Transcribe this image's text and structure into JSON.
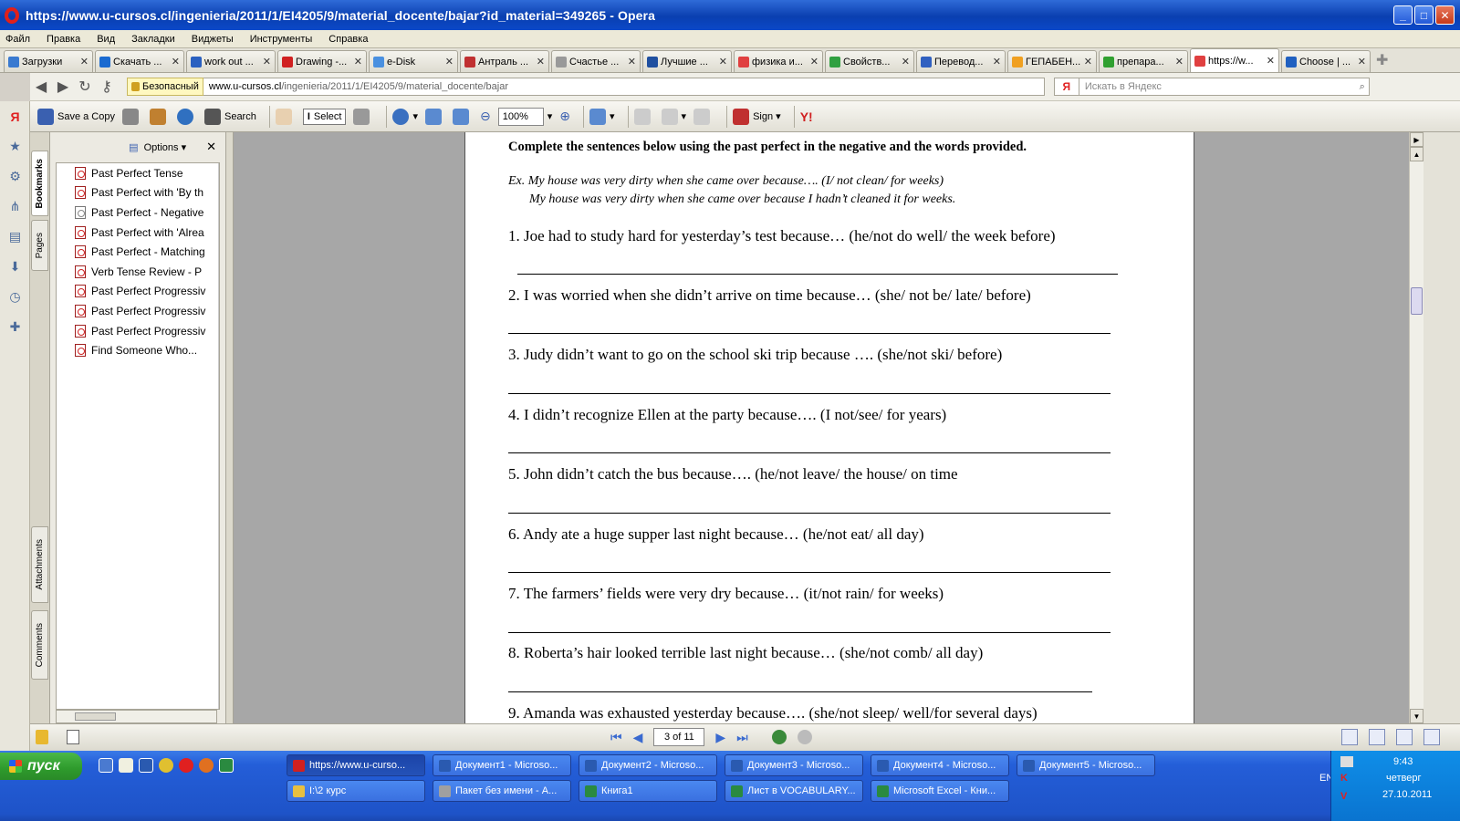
{
  "window": {
    "title": "https://www.u-cursos.cl/ingenieria/2011/1/EI4205/9/material_docente/bajar?id_material=349265 - Opera"
  },
  "menu": [
    "Файл",
    "Правка",
    "Вид",
    "Закладки",
    "Виджеты",
    "Инструменты",
    "Справка"
  ],
  "tabs": [
    {
      "label": "Загрузки",
      "color": "#3a7ad0"
    },
    {
      "label": "Скачать ...",
      "color": "#1a6ad0"
    },
    {
      "label": "work out ...",
      "color": "#2a60c0"
    },
    {
      "label": "Drawing -...",
      "color": "#d02020"
    },
    {
      "label": "e-Disk",
      "color": "#4a90e0"
    },
    {
      "label": "Антраль ...",
      "color": "#c03030"
    },
    {
      "label": "Счастье ...",
      "color": "#999999"
    },
    {
      "label": "Лучшие ...",
      "color": "#2050a0"
    },
    {
      "label": "физика и...",
      "color": "#e04040"
    },
    {
      "label": "Свойств...",
      "color": "#30a040"
    },
    {
      "label": "Перевод...",
      "color": "#3060c0"
    },
    {
      "label": "ГЕПАБЕН...",
      "color": "#f0a020"
    },
    {
      "label": "препара...",
      "color": "#30a030"
    },
    {
      "label": "https://w...",
      "color": "#e04040",
      "active": true
    },
    {
      "label": "Choose | ...",
      "color": "#2060c0"
    }
  ],
  "address": {
    "secure_label": "Безопасный",
    "url_host": "www.u-cursos.cl",
    "url_path": "/ingenieria/2011/1/EI4205/9/material_docente/bajar",
    "search_placeholder": "Искать в Яндекс",
    "search_engine": "Я"
  },
  "reader_toolbar": {
    "save_copy": "Save a Copy",
    "search": "Search",
    "select": "Select",
    "zoom": "100%",
    "sign": "Sign"
  },
  "bookmarks_panel": {
    "tab_bookmarks": "Bookmarks",
    "tab_pages": "Pages",
    "tab_attachments": "Attachments",
    "tab_comments": "Comments",
    "options": "Options",
    "items": [
      "Past Perfect Tense",
      "Past Perfect with 'By th",
      "Past Perfect - Negative",
      "Past Perfect with 'Alrea",
      "Past Perfect - Matching",
      "Verb Tense Review - P",
      "Past Perfect Progressiv",
      "Past Perfect Progressiv",
      "Past Perfect Progressiv",
      "Find Someone Who..."
    ]
  },
  "document": {
    "instruction": "Complete the sentences below using the past perfect in the negative and the words provided.",
    "example_1": "Ex.  My house was very dirty when she came over because…. (I/ not clean/ for weeks)",
    "example_2": "My house was very dirty when she came over because I hadn’t cleaned it for weeks.",
    "questions": [
      "1. Joe had to study hard for yesterday’s test because… (he/not do well/ the week before)",
      "2. I was worried when she didn’t arrive on time because… (she/ not be/ late/ before)",
      "3. Judy didn’t want to go on the school ski trip because …. (she/not ski/ before)",
      "4. I didn’t recognize Ellen at the party because…. (I not/see/ for years)",
      "5. John didn’t catch the bus because…. (he/not leave/ the house/ on time",
      "6. Andy ate a huge supper last night because… (he/not eat/ all day)",
      "7. The farmers’ fields were very dry because… (it/not rain/ for weeks)",
      "8. Roberta’s hair looked terrible last night because… (she/not comb/ all day)",
      "9. Amanda was exhausted yesterday because…. (she/not sleep/ well/for several days)"
    ]
  },
  "page_nav": {
    "page_indicator": "3 of 11"
  },
  "taskbar": {
    "start": "пуск",
    "buttons_row1": [
      {
        "label": "https://www.u-curso...",
        "color": "#d02020",
        "active": true
      },
      {
        "label": "Документ1 - Microso...",
        "color": "#2a5ab0"
      },
      {
        "label": "Документ2 - Microso...",
        "color": "#2a5ab0"
      },
      {
        "label": "Документ3 - Microso...",
        "color": "#2a5ab0"
      },
      {
        "label": "Документ4 - Microso...",
        "color": "#2a5ab0"
      },
      {
        "label": "Документ5 - Microso...",
        "color": "#2a5ab0"
      }
    ],
    "buttons_row2": [
      {
        "label": "I:\\2 курс",
        "color": "#e8c040"
      },
      {
        "label": "Пакет без имени - А...",
        "color": "#a0a0a0"
      },
      {
        "label": "Книга1",
        "color": "#2a8a40"
      },
      {
        "label": "Лист в VOCABULARY...",
        "color": "#2a8a40"
      },
      {
        "label": "Microsoft Excel - Кни...",
        "color": "#2a8a40"
      }
    ],
    "lang": "EN",
    "time": "9:43",
    "day": "четверг",
    "date": "27.10.2011"
  }
}
